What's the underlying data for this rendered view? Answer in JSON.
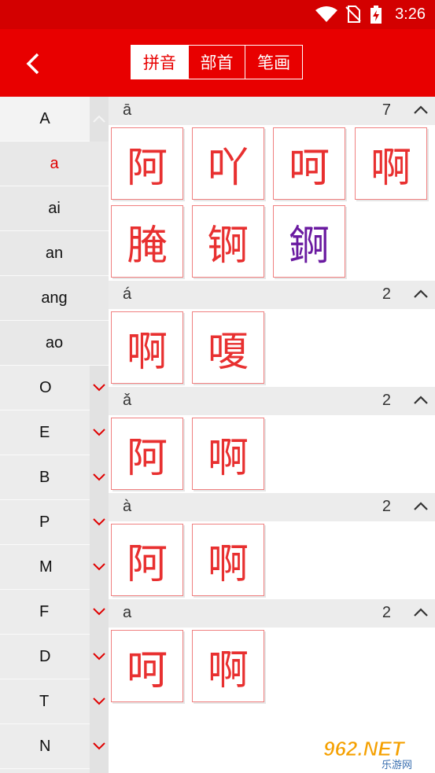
{
  "status": {
    "time": "3:26"
  },
  "header": {
    "tabs": [
      "拼音",
      "部首",
      "笔画"
    ]
  },
  "sidebar": {
    "top_letter": "A",
    "sub_items": [
      "a",
      "ai",
      "an",
      "ang",
      "ao"
    ],
    "active_sub": "a",
    "letters": [
      "O",
      "E",
      "B",
      "P",
      "M",
      "F",
      "D",
      "T",
      "N"
    ]
  },
  "sections": [
    {
      "pinyin": "ā",
      "count": "7",
      "chars": [
        "阿",
        "吖",
        "呵",
        "啊",
        "腌",
        "锕",
        "錒"
      ]
    },
    {
      "pinyin": "á",
      "count": "2",
      "chars": [
        "啊",
        "嗄"
      ]
    },
    {
      "pinyin": "ǎ",
      "count": "2",
      "chars": [
        "阿",
        "啊"
      ]
    },
    {
      "pinyin": "à",
      "count": "2",
      "chars": [
        "阿",
        "啊"
      ]
    },
    {
      "pinyin": "a",
      "count": "2",
      "chars": [
        "呵",
        "啊"
      ]
    }
  ],
  "watermark": {
    "text": "962.NET",
    "sub": "乐游网"
  },
  "colors": {
    "brand": "#e80000",
    "char": "#e83030",
    "trad_char": "#6a1aa0"
  }
}
